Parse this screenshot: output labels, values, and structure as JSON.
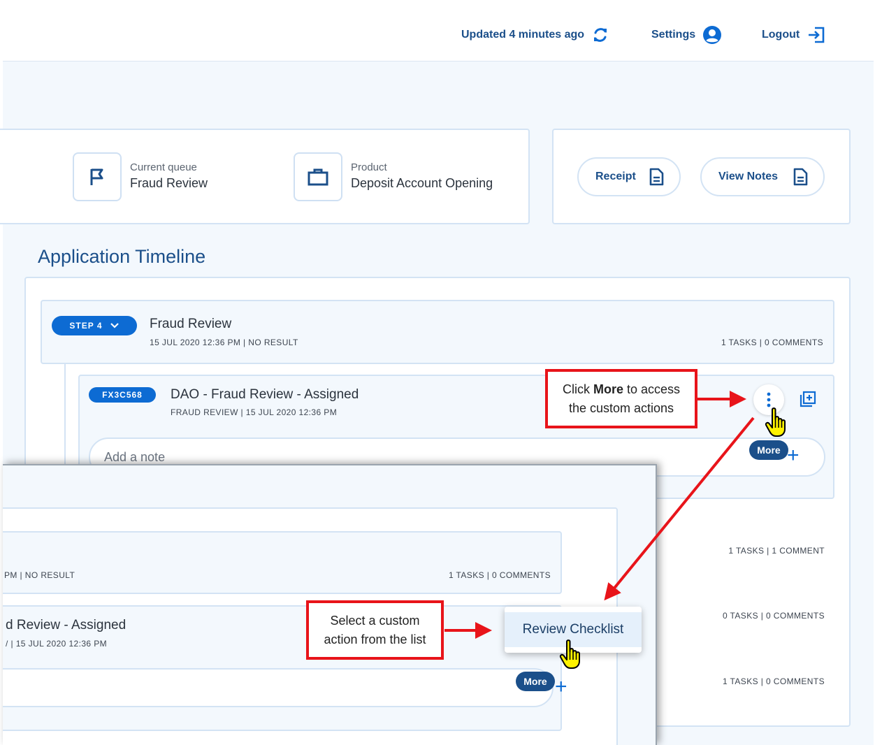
{
  "topbar": {
    "updated_label": "Updated 4 minutes ago",
    "settings_label": "Settings",
    "logout_label": "Logout"
  },
  "summary": {
    "queue_label": "Current queue",
    "queue_value": "Fraud Review",
    "product_label": "Product",
    "product_value": "Deposit Account Opening"
  },
  "actions": {
    "receipt_label": "Receipt",
    "view_notes_label": "View Notes"
  },
  "timeline": {
    "title": "Application Timeline",
    "step": {
      "badge": "STEP 4",
      "title": "Fraud Review",
      "meta": "15 JUL 2020 12:36 PM | NO RESULT",
      "counts": "1 TASKS | 0 COMMENTS"
    },
    "task": {
      "id": "FX3C568",
      "title": "DAO - Fraud Review - Assigned",
      "meta": "FRAUD REVIEW | 15 JUL 2020 12:36 PM",
      "note_placeholder": "Add a note",
      "more_label": "More"
    },
    "other_counts": [
      "1 TASKS | 1 COMMENT",
      "0 TASKS | 0 COMMENTS",
      "1 TASKS | 0 COMMENTS"
    ]
  },
  "overlay": {
    "step_meta": "PM | NO RESULT",
    "step_counts": "1 TASKS | 0 COMMENTS",
    "task_title": "d Review - Assigned",
    "task_meta": "/ | 15 JUL 2020 12:36 PM",
    "more_label": "More"
  },
  "menu": {
    "item": "Review Checklist"
  },
  "callouts": {
    "click_more_prefix": "Click ",
    "click_more_bold": "More",
    "click_more_suffix": " to access",
    "click_more_line2": "the custom actions",
    "select_line1": "Select a custom",
    "select_line2": "action from the list"
  },
  "colors": {
    "brand": "#1b4f8a",
    "accent": "#0d6bd3",
    "callout": "#e8141a",
    "background": "#f3f8fd"
  }
}
